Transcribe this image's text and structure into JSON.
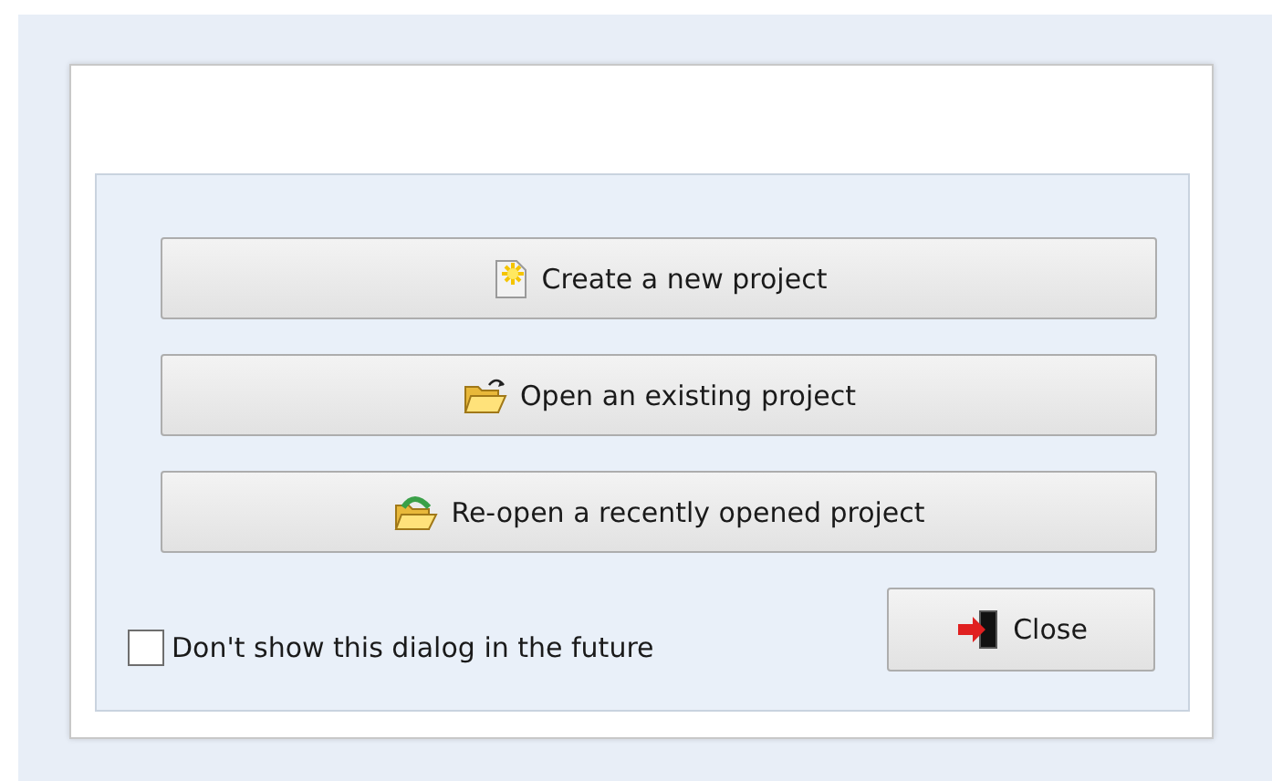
{
  "actions": [
    {
      "kind": "new",
      "label": "Create a new project"
    },
    {
      "kind": "open",
      "label": "Open an existing project"
    },
    {
      "kind": "reopen",
      "label": "Re-open a recently opened project"
    }
  ],
  "dont_show": {
    "label": "Don't show this dialog in the future",
    "checked": false
  },
  "close_button": {
    "label": "Close"
  }
}
